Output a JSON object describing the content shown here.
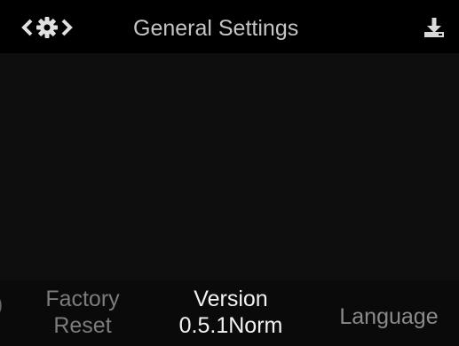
{
  "header": {
    "title": "General Settings",
    "left_icons": [
      "chevron-left-icon",
      "gear-icon",
      "chevron-right-icon"
    ],
    "right_icon": "download-icon"
  },
  "menu": {
    "items": [
      {
        "line1": "Factory",
        "line2": "Reset",
        "state": "inactive"
      },
      {
        "line1": "Version",
        "line2": "0.5.1Norm",
        "state": "selected"
      },
      {
        "line1": "Language",
        "state": "inactive"
      }
    ]
  },
  "colors": {
    "background": "#0b0b0b",
    "header": "#000000",
    "title_text": "#c4c4c4",
    "selected_text": "#f2f2f2",
    "inactive_text": "#7c7c7c"
  }
}
